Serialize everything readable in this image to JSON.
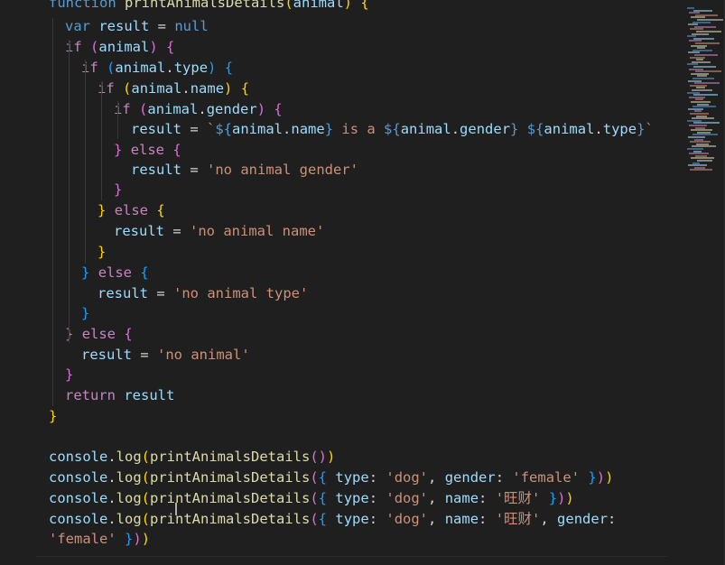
{
  "editor": {
    "language": "javascript",
    "colors": {
      "background": "#1f1f1f",
      "keyword": "#569cd6",
      "control": "#c586c0",
      "variable": "#9cdcfe",
      "function": "#dcdcaa",
      "string": "#ce9178",
      "bracket_gold": "#ffd700",
      "bracket_purple": "#da70d6",
      "bracket_blue": "#179fff"
    },
    "lines": [
      {
        "tokens": [
          [
            "kw",
            "function"
          ],
          [
            "pl",
            " "
          ],
          [
            "fn",
            "printAnimalsDetails"
          ],
          [
            "bx",
            "("
          ],
          [
            "var",
            "animal"
          ],
          [
            "bx",
            ")"
          ],
          [
            "pl",
            " "
          ],
          [
            "bx",
            "{"
          ]
        ]
      },
      {
        "tokens": [
          [
            "kw",
            "var"
          ],
          [
            "pl",
            " "
          ],
          [
            "var",
            "result"
          ],
          [
            "pl",
            " = "
          ],
          [
            "kw",
            "null"
          ]
        ]
      },
      {
        "tokens": [
          [
            "ctl",
            "if"
          ],
          [
            "pl",
            " "
          ],
          [
            "bp",
            "("
          ],
          [
            "var",
            "animal"
          ],
          [
            "bp",
            ")"
          ],
          [
            "pl",
            " "
          ],
          [
            "bp",
            "{"
          ]
        ]
      },
      {
        "tokens": [
          [
            "ctl",
            "if"
          ],
          [
            "pl",
            " "
          ],
          [
            "bb",
            "("
          ],
          [
            "var",
            "animal"
          ],
          [
            "pl",
            "."
          ],
          [
            "var",
            "type"
          ],
          [
            "bb",
            ")"
          ],
          [
            "pl",
            " "
          ],
          [
            "bb",
            "{"
          ]
        ]
      },
      {
        "tokens": [
          [
            "ctl",
            "if"
          ],
          [
            "pl",
            " "
          ],
          [
            "bx",
            "("
          ],
          [
            "var",
            "animal"
          ],
          [
            "pl",
            "."
          ],
          [
            "var",
            "name"
          ],
          [
            "bx",
            ")"
          ],
          [
            "pl",
            " "
          ],
          [
            "bx",
            "{"
          ]
        ]
      },
      {
        "tokens": [
          [
            "ctl",
            "if"
          ],
          [
            "pl",
            " "
          ],
          [
            "bp",
            "("
          ],
          [
            "var",
            "animal"
          ],
          [
            "pl",
            "."
          ],
          [
            "var",
            "gender"
          ],
          [
            "bp",
            ")"
          ],
          [
            "pl",
            " "
          ],
          [
            "bp",
            "{"
          ]
        ]
      },
      {
        "tokens": [
          [
            "var",
            "result"
          ],
          [
            "pl",
            " = "
          ],
          [
            "str",
            "`"
          ],
          [
            "tpl",
            "${"
          ],
          [
            "var",
            "animal"
          ],
          [
            "pl",
            "."
          ],
          [
            "var",
            "name"
          ],
          [
            "tpl",
            "}"
          ],
          [
            "str",
            " is a "
          ],
          [
            "tpl",
            "${"
          ],
          [
            "var",
            "animal"
          ],
          [
            "pl",
            "."
          ],
          [
            "var",
            "gender"
          ],
          [
            "tpl",
            "}"
          ],
          [
            "str",
            " "
          ],
          [
            "tpl",
            "${"
          ],
          [
            "var",
            "animal"
          ],
          [
            "pl",
            "."
          ],
          [
            "var",
            "type"
          ],
          [
            "tpl",
            "}"
          ],
          [
            "str",
            "`"
          ]
        ]
      },
      {
        "tokens": [
          [
            "bp",
            "}"
          ],
          [
            "pl",
            " "
          ],
          [
            "ctl",
            "else"
          ],
          [
            "pl",
            " "
          ],
          [
            "bp",
            "{"
          ]
        ]
      },
      {
        "tokens": [
          [
            "var",
            "result"
          ],
          [
            "pl",
            " = "
          ],
          [
            "str",
            "'no animal gender'"
          ]
        ]
      },
      {
        "tokens": [
          [
            "bp",
            "}"
          ]
        ]
      },
      {
        "tokens": [
          [
            "bx",
            "}"
          ],
          [
            "pl",
            " "
          ],
          [
            "ctl",
            "else"
          ],
          [
            "pl",
            " "
          ],
          [
            "bx",
            "{"
          ]
        ]
      },
      {
        "tokens": [
          [
            "var",
            "result"
          ],
          [
            "pl",
            " = "
          ],
          [
            "str",
            "'no animal name'"
          ]
        ]
      },
      {
        "tokens": [
          [
            "bx",
            "}"
          ]
        ]
      },
      {
        "tokens": [
          [
            "bb",
            "}"
          ],
          [
            "pl",
            " "
          ],
          [
            "ctl",
            "else"
          ],
          [
            "pl",
            " "
          ],
          [
            "bb",
            "{"
          ]
        ]
      },
      {
        "tokens": [
          [
            "var",
            "result"
          ],
          [
            "pl",
            " = "
          ],
          [
            "str",
            "'no animal type'"
          ]
        ]
      },
      {
        "tokens": [
          [
            "bb",
            "}"
          ]
        ]
      },
      {
        "tokens": [
          [
            "bp",
            "}"
          ],
          [
            "pl",
            " "
          ],
          [
            "ctl",
            "else"
          ],
          [
            "pl",
            " "
          ],
          [
            "bp",
            "{"
          ]
        ]
      },
      {
        "tokens": [
          [
            "var",
            "result"
          ],
          [
            "pl",
            " = "
          ],
          [
            "str",
            "'no animal'"
          ]
        ]
      },
      {
        "tokens": [
          [
            "bp",
            "}"
          ]
        ]
      },
      {
        "tokens": [
          [
            "ctl",
            "return"
          ],
          [
            "pl",
            " "
          ],
          [
            "var",
            "result"
          ]
        ]
      },
      {
        "tokens": [
          [
            "bx",
            "}"
          ]
        ]
      },
      {
        "tokens": []
      },
      {
        "tokens": [
          [
            "var",
            "console"
          ],
          [
            "pl",
            "."
          ],
          [
            "fn",
            "log"
          ],
          [
            "bx",
            "("
          ],
          [
            "fn",
            "printAnimalsDetails"
          ],
          [
            "bp",
            "("
          ],
          [
            "bp",
            ")"
          ],
          [
            "bx",
            ")"
          ]
        ]
      },
      {
        "tokens": [
          [
            "var",
            "console"
          ],
          [
            "pl",
            "."
          ],
          [
            "fn",
            "log"
          ],
          [
            "bx",
            "("
          ],
          [
            "fn",
            "printAnimalsDetails"
          ],
          [
            "bp",
            "("
          ],
          [
            "bb",
            "{"
          ],
          [
            "pl",
            " "
          ],
          [
            "var",
            "type"
          ],
          [
            "pl",
            ": "
          ],
          [
            "str",
            "'dog'"
          ],
          [
            "pl",
            ", "
          ],
          [
            "var",
            "gender"
          ],
          [
            "pl",
            ": "
          ],
          [
            "str",
            "'female'"
          ],
          [
            "pl",
            " "
          ],
          [
            "bb",
            "}"
          ],
          [
            "bp",
            ")"
          ],
          [
            "bx",
            ")"
          ]
        ]
      },
      {
        "tokens": [
          [
            "var",
            "console"
          ],
          [
            "pl",
            "."
          ],
          [
            "fn",
            "log"
          ],
          [
            "bx",
            "("
          ],
          [
            "fn",
            "printAnimalsDetails"
          ],
          [
            "bp",
            "("
          ],
          [
            "bb",
            "{"
          ],
          [
            "pl",
            " "
          ],
          [
            "var",
            "type"
          ],
          [
            "pl",
            ": "
          ],
          [
            "str",
            "'dog'"
          ],
          [
            "pl",
            ", "
          ],
          [
            "var",
            "name"
          ],
          [
            "pl",
            ": "
          ],
          [
            "str",
            "'旺财'"
          ],
          [
            "pl",
            " "
          ],
          [
            "bb",
            "}"
          ],
          [
            "bp",
            ")"
          ],
          [
            "bx",
            ")"
          ]
        ]
      },
      {
        "tokens": [
          [
            "var",
            "console"
          ],
          [
            "pl",
            "."
          ],
          [
            "fn",
            "log"
          ],
          [
            "bx",
            "("
          ],
          [
            "fn",
            "printAnimalsDetails"
          ],
          [
            "bp",
            "("
          ],
          [
            "bb",
            "{"
          ],
          [
            "pl",
            " "
          ],
          [
            "var",
            "type"
          ],
          [
            "pl",
            ": "
          ],
          [
            "str",
            "'dog'"
          ],
          [
            "pl",
            ", "
          ],
          [
            "var",
            "name"
          ],
          [
            "pl",
            ": "
          ],
          [
            "str",
            "'旺财'"
          ],
          [
            "pl",
            ", "
          ],
          [
            "var",
            "gender"
          ],
          [
            "pl",
            ":"
          ]
        ]
      },
      {
        "tokens": [
          [
            "str",
            "'female'"
          ],
          [
            "pl",
            " "
          ],
          [
            "bb",
            "}"
          ],
          [
            "bp",
            ")"
          ],
          [
            "bx",
            ")"
          ]
        ]
      }
    ]
  }
}
